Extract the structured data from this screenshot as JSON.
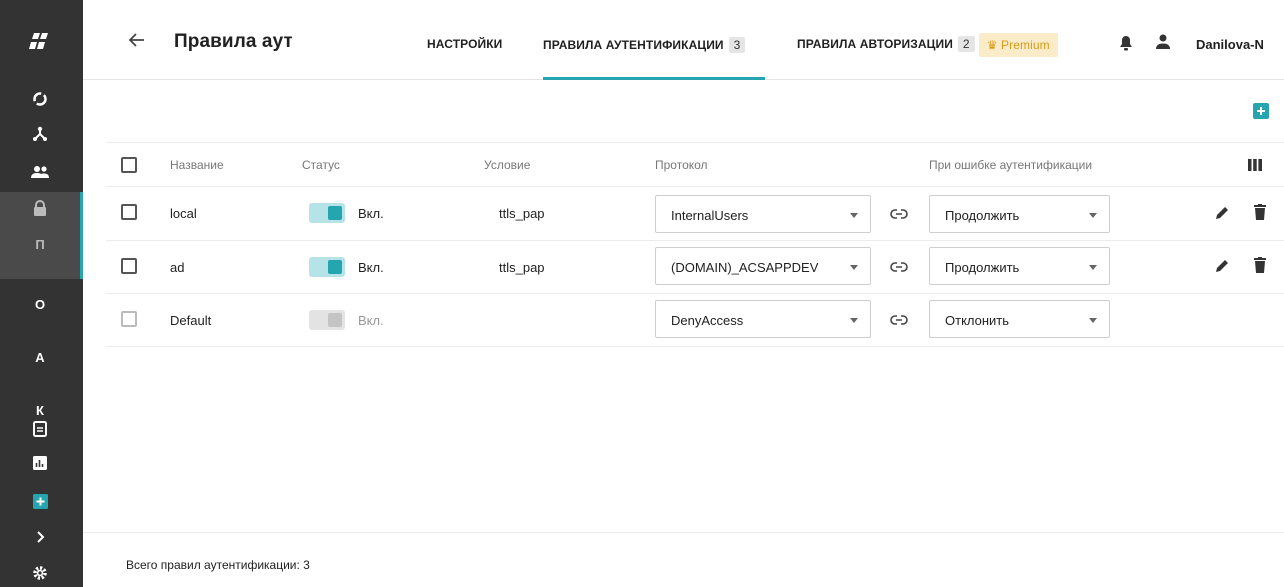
{
  "sidebar": {
    "letters": [
      "П",
      "О",
      "А",
      "К"
    ],
    "icons": [
      "logo-icon",
      "circle-icon",
      "hierarchy-icon",
      "users-icon",
      "lock-icon",
      "document-icon",
      "report-icon",
      "add-icon",
      "chevron-right-icon",
      "gear-icon"
    ]
  },
  "header": {
    "title": "Правила аутентифик",
    "tabs": [
      {
        "label": "НАСТРОЙКИ",
        "count": ""
      },
      {
        "label": "ПРАВИЛА АУТЕНТИФИКАЦИИ",
        "count": "3"
      },
      {
        "label": "ПРАВИЛА АВТОРИЗАЦИИ",
        "count": "2"
      }
    ],
    "premium": "Premium",
    "username": "Danilova-N"
  },
  "table": {
    "columns": [
      "Название",
      "Статус",
      "Условие",
      "Протокол",
      "При ошибке аутентификации"
    ],
    "rows": [
      {
        "name": "local",
        "status": "Вкл.",
        "condition": "ttls_pap",
        "protocol": "InternalUsers",
        "on_error": "Продолжить",
        "enabled": true
      },
      {
        "name": "ad",
        "status": "Вкл.",
        "condition": "ttls_pap",
        "protocol": "(DOMAIN)_ACSAPPDEV",
        "on_error": "Продолжить",
        "enabled": true
      },
      {
        "name": "Default",
        "status": "Вкл.",
        "condition": "",
        "protocol": "DenyAccess",
        "on_error": "Отклонить",
        "enabled": false
      }
    ]
  },
  "footer": {
    "total": "Всего правил аутентификации: 3"
  },
  "colors": {
    "accent": "#26a5b0",
    "sidebar": "#333333",
    "premium_bg": "#faecc9",
    "premium_fg": "#d99a18"
  }
}
